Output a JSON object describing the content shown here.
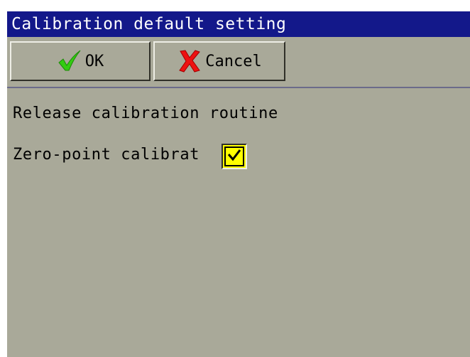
{
  "dialog": {
    "title": "Calibration default setting"
  },
  "toolbar": {
    "ok_label": "OK",
    "ok_icon": "checkmark-icon",
    "ok_icon_color": "#33cc11",
    "cancel_label": "Cancel",
    "cancel_icon": "x-icon",
    "cancel_icon_color": "#ee1111"
  },
  "content": {
    "section_label": "Release calibration routine",
    "zero_point_label": "Zero-point calibrat",
    "zero_point_checked": true
  },
  "colors": {
    "title_bar": "#13188a",
    "panel_background": "#a9a999",
    "checkbox_fill": "#ffff00"
  }
}
